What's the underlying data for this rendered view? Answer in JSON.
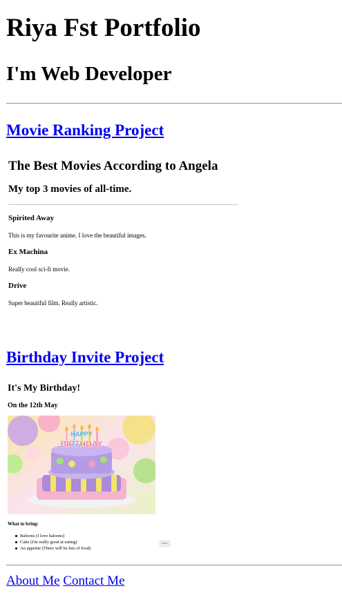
{
  "header": {
    "title": "Riya Fst Portfolio",
    "subtitle": "I'm Web Developer"
  },
  "projects": [
    {
      "link_label": "Movie Ranking Project",
      "preview": {
        "heading": "The Best Movies According to Angela",
        "subheading": "My top 3 movies of all-time.",
        "movies": [
          {
            "name": "Spirited Away",
            "description": "This is my favourite anime. I love the beautiful images."
          },
          {
            "name": "Ex Machina",
            "description": "Really cool sci-fi movie."
          },
          {
            "name": "Drive",
            "description": "Super beautiful film. Really artistic."
          }
        ]
      }
    },
    {
      "link_label": "Birthday Invite Project",
      "preview": {
        "heading": "It's My Birthday!",
        "date_line": "On the 12th May",
        "image_alt": "birthday cake with candles",
        "bring_heading": "What to bring:",
        "bring_items": [
          "Baloons (I love baloons)",
          "Cake (I'm really good at eating)",
          "An appetite (There will be lots of food)"
        ],
        "button_label": "Button"
      }
    }
  ],
  "footer": {
    "about_label": "About Me",
    "contact_label": "Contact Me"
  },
  "colors": {
    "link": "#0000ee",
    "rule": "#9a9a9a"
  }
}
